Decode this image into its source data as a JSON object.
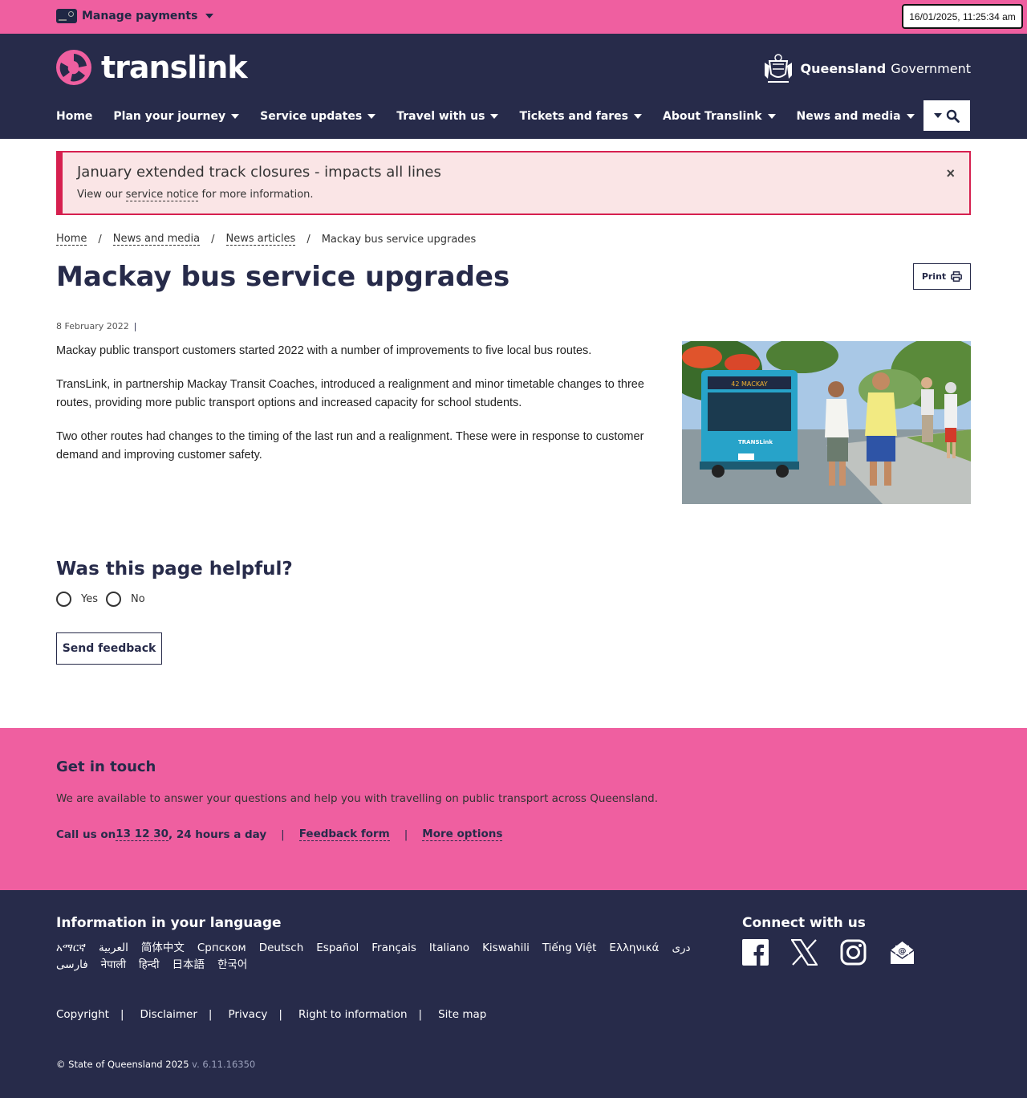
{
  "utility": {
    "manage_payments": "Manage payments",
    "clock": "16/01/2025, 11:25:34 am"
  },
  "header": {
    "logo_text": "translink",
    "gov_bold": "Queensland",
    "gov_light": "Government",
    "nav": [
      {
        "label": "Home"
      },
      {
        "label": "Plan your journey"
      },
      {
        "label": "Service updates"
      },
      {
        "label": "Travel with us"
      },
      {
        "label": "Tickets and fares"
      },
      {
        "label": "About Translink"
      },
      {
        "label": "News and media"
      }
    ]
  },
  "alert": {
    "title": "January extended track closures - impacts all lines",
    "body_prefix": "View our ",
    "body_link": "service notice",
    "body_suffix": " for more information.",
    "close": "×"
  },
  "breadcrumb": {
    "items": [
      "Home",
      "News and media",
      "News articles"
    ],
    "current": "Mackay bus service upgrades",
    "separator": "/"
  },
  "page": {
    "title": "Mackay bus service upgrades",
    "print_label": "Print",
    "date": "8 February 2022",
    "date_bar": "|",
    "paragraphs": [
      "Mackay public transport customers started 2022 with a number of improvements to five local bus routes.",
      "TransLink, in partnership Mackay Transit Coaches, introduced a realignment and minor timetable changes to three routes, providing more public transport options and increased capacity for school students.",
      "Two other routes had changes to the timing of the last run and a realignment. These were in response to customer demand and improving customer safety."
    ],
    "bus_signage": "TRANSLink"
  },
  "feedback": {
    "title": "Was this page helpful?",
    "yes": "Yes",
    "no": "No",
    "send": "Send feedback"
  },
  "touch": {
    "title": "Get in touch",
    "text": "We are available to answer your questions and help you with travelling on public transport across Queensland.",
    "call_prefix": "Call us on ",
    "phone": "13 12 30",
    "call_suffix": ", 24 hours a day",
    "feedback_form": "Feedback form",
    "more_options": "More options",
    "sep": "|"
  },
  "footer": {
    "lang_title": "Information in your language",
    "languages": [
      "አማርኛ",
      "العربية",
      "简体中文",
      "Српском",
      "Deutsch",
      "Español",
      "Français",
      "Italiano",
      "Kiswahili",
      "Tiếng Việt",
      "Ελληνικά",
      "دری",
      "فارسی",
      "नेपाली",
      "हिन्दी",
      "日本語",
      "한국어"
    ],
    "connect_title": "Connect with us",
    "social_icons": [
      "facebook-icon",
      "x-icon",
      "instagram-icon",
      "email-icon"
    ],
    "links": [
      "Copyright",
      "Disclaimer",
      "Privacy",
      "Right to information",
      "Site map"
    ],
    "sep": "|",
    "copyright": "© State of Queensland 2025",
    "version": " v. 6.11.16350"
  },
  "colors": {
    "pink": "#ef5fa0",
    "navy": "#272b4a",
    "alert_bg": "#fae5e6",
    "alert_border": "#d6204f"
  }
}
